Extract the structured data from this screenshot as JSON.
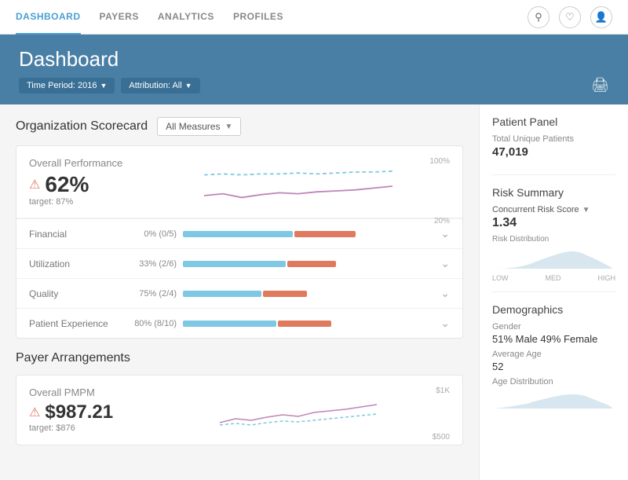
{
  "nav": {
    "links": [
      {
        "label": "DASHBOARD",
        "active": true
      },
      {
        "label": "PAYERS",
        "active": false
      },
      {
        "label": "ANALYTICS",
        "active": false
      },
      {
        "label": "PROFILES",
        "active": false
      }
    ]
  },
  "header": {
    "title": "Dashboard",
    "filters": [
      {
        "label": "Time Period: 2016"
      },
      {
        "label": "Attribution: All"
      }
    ],
    "print_label": "⊟"
  },
  "scorecard": {
    "title": "Organization Scorecard",
    "dropdown": "All Measures",
    "overall": {
      "label": "Overall Performance",
      "percent": "62%",
      "target": "target: 87%",
      "chart_top_label": "100%",
      "chart_bottom_label": "20%"
    },
    "metrics": [
      {
        "name": "Financial",
        "stats": "0% (0/5)",
        "blue_pct": 45,
        "red_pct": 25
      },
      {
        "name": "Utilization",
        "stats": "33% (2/6)",
        "blue_pct": 42,
        "red_pct": 20
      },
      {
        "name": "Quality",
        "stats": "75% (2/4)",
        "blue_pct": 32,
        "red_pct": 18
      },
      {
        "name": "Patient Experience",
        "stats": "80% (8/10)",
        "blue_pct": 38,
        "red_pct": 22
      }
    ]
  },
  "payer": {
    "title": "Payer Arrangements",
    "overall_label": "Overall PMPM",
    "value": "$987.21",
    "target": "target: $876",
    "chart_top": "$1K",
    "chart_bottom": "$500"
  },
  "right_panel": {
    "patient_panel": {
      "title": "Patient Panel",
      "total_label": "Total Unique Patients",
      "total_value": "47,019"
    },
    "risk_summary": {
      "title": "Risk Summary",
      "score_label": "Concurrent Risk Score",
      "score_value": "1.34",
      "dist_label": "Risk Distribution",
      "dist_low": "LOW",
      "dist_med": "MED",
      "dist_high": "HIGH"
    },
    "demographics": {
      "title": "Demographics",
      "gender_label": "Gender",
      "gender_value": "51% Male   49% Female",
      "age_label": "Average Age",
      "age_value": "52",
      "age_dist_label": "Age Distribution"
    }
  }
}
